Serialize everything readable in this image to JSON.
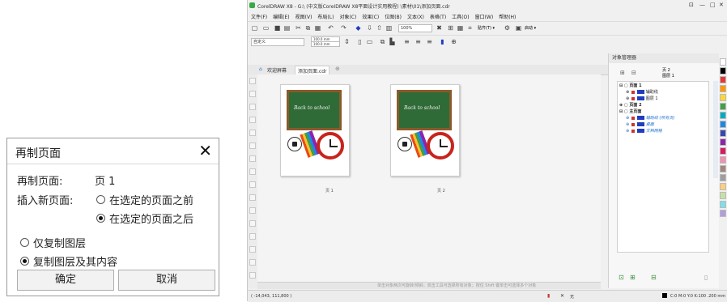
{
  "dialog": {
    "title": "再制页面",
    "close_glyph": "✕",
    "duplicate_page_label": "再制页面:",
    "duplicate_page_value": "页 1",
    "insert_label": "插入新页面:",
    "insert_before": "在选定的页面之前",
    "insert_after": "在选定的页面之后",
    "insert_selected": "after",
    "copy_layers_only": "仅复制图层",
    "copy_layers_and_contents": "复制图层及其内容",
    "copy_selected": "layers_and_contents",
    "ok": "确定",
    "cancel": "取消"
  },
  "app": {
    "title": "CorelDRAW X8 - G:\\ (中文版CoreIDRAW X8平面设计实用教程) \\素材\\01\\添加页面.cdr",
    "window_controls": [
      "⊡",
      "—",
      "□",
      "✕"
    ],
    "menu": [
      "文件(F)",
      "编辑(E)",
      "视图(V)",
      "布局(L)",
      "对象(C)",
      "效果(C)",
      "位图(B)",
      "文本(X)",
      "表格(T)",
      "工具(O)",
      "窗口(W)",
      "帮助(H)"
    ],
    "zoom": "100%",
    "snap_label": "贴齐(T) ▾",
    "settings_label": "启动 ▾",
    "page_size_select": "自定义",
    "width": "100.0 mm",
    "height": "100.0 mm",
    "tabs": [
      "欢迎屏幕",
      "添加页面.cdr"
    ],
    "pages": [
      {
        "label": "页 1",
        "board_text": "Back to school"
      },
      {
        "label": "页 2",
        "board_text": "Back to school"
      }
    ],
    "hint": "单击对象两次可旋转/倾斜；双击工具可选择所有对象；按住 Shift 键单击可选择多个对象",
    "coords": "( -14,043, 111,800 )",
    "fill_status": "C:0 M:0 Y:0 K:100  .200 mm",
    "none_label": "无"
  },
  "object_manager": {
    "title": "对象管理器",
    "current_page": "页 2",
    "current_layer": "图层 1",
    "tree": [
      {
        "text": "页面 1",
        "style": "bold"
      },
      {
        "text": "辅助线",
        "style": "italic"
      },
      {
        "text": "图层 1",
        "style": "normal"
      },
      {
        "text": "页面 2",
        "style": "bold"
      },
      {
        "text": "主页面",
        "style": "bold"
      },
      {
        "text": "辅助线 (所有页)",
        "style": "blue"
      },
      {
        "text": "桌面",
        "style": "blue"
      },
      {
        "text": "文档网格",
        "style": "blue"
      }
    ]
  },
  "colors": {
    "accent": "#1c6fd1",
    "board": "#2f6b36",
    "frame": "#8a5a2b",
    "clock": "#c8241b",
    "palette": [
      "#ffffff",
      "#000000",
      "#e53935",
      "#ff9800",
      "#fdd835",
      "#43a047",
      "#00acc1",
      "#1e88e5",
      "#3949ab",
      "#8e24aa",
      "#d81b60",
      "#f48fb1",
      "#a1887f",
      "#9e9e9e",
      "#ffcc80",
      "#c5e1a5",
      "#80deea",
      "#b39ddb"
    ]
  }
}
